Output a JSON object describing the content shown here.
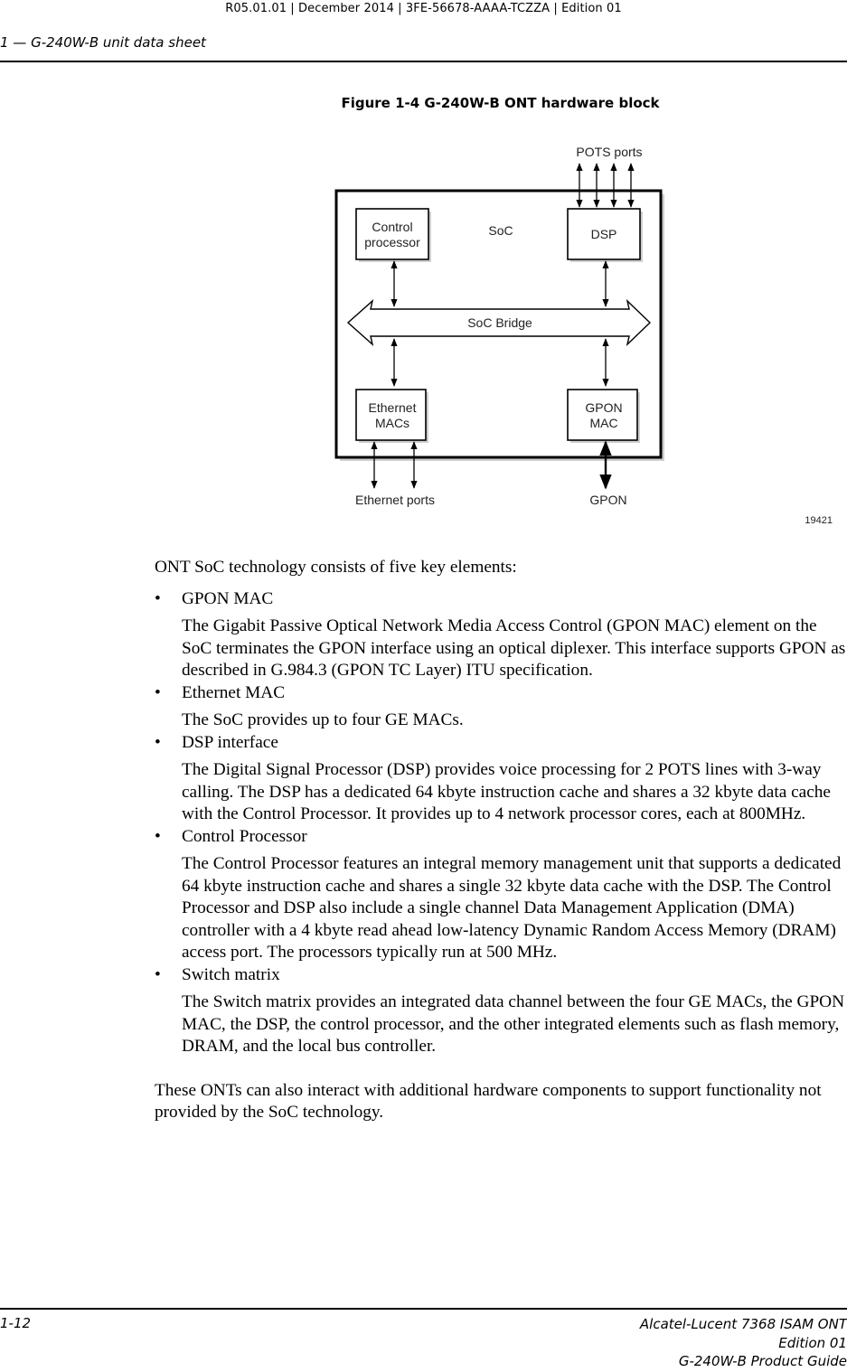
{
  "header": {
    "doc_meta": "R05.01.01 | December 2014 | 3FE-56678-AAAA-TCZZA | Edition 01",
    "chapter": "1 —  G-240W-B unit data sheet"
  },
  "figure": {
    "title": "Figure 1-4  G-240W-B ONT hardware block",
    "id": "19421",
    "labels": {
      "pots_ports": "POTS ports",
      "soc": "SoC",
      "control_processor_line1": "Control",
      "control_processor_line2": "processor",
      "dsp": "DSP",
      "soc_bridge": "SoC Bridge",
      "ethernet_macs_line1": "Ethernet",
      "ethernet_macs_line2": "MACs",
      "gpon_mac_line1": "GPON",
      "gpon_mac_line2": "MAC",
      "ethernet_ports": "Ethernet ports",
      "gpon": "GPON"
    }
  },
  "body": {
    "intro": "ONT SoC technology consists of five key elements:",
    "bullet_glyph": "•",
    "items": [
      {
        "heading": "GPON MAC",
        "text": "The Gigabit Passive Optical Network Media Access Control (GPON MAC) element on the SoC terminates the GPON interface using an optical diplexer. This interface supports GPON as described in G.984.3 (GPON TC Layer) ITU specification."
      },
      {
        "heading": "Ethernet MAC",
        "text": "The SoC provides up to four GE MACs."
      },
      {
        "heading": "DSP interface",
        "text": "The Digital Signal Processor (DSP) provides voice processing for 2 POTS lines with 3-way calling. The DSP has a dedicated 64 kbyte instruction cache and shares a 32 kbyte data cache with the Control Processor. It provides up to 4 network processor cores, each at 800MHz."
      },
      {
        "heading": "Control Processor",
        "text": "The Control Processor features an integral memory management unit that supports a dedicated 64 kbyte instruction cache and shares a single 32 kbyte data cache with the DSP. The Control Processor and DSP also include a single channel Data Management Application (DMA) controller with a 4 kbyte read ahead low-latency Dynamic Random Access Memory (DRAM) access port. The processors typically run at 500 MHz."
      },
      {
        "heading": "Switch matrix",
        "text": "The Switch matrix provides an integrated data channel between the four GE MACs, the GPON MAC, the DSP, the control processor, and the other integrated elements such as flash memory, DRAM, and the local bus controller."
      }
    ],
    "outro": "These ONTs can also interact with additional hardware components to support functionality not provided by the SoC technology."
  },
  "footer": {
    "page_number": "1-12",
    "product": "Alcatel-Lucent 7368 ISAM ONT",
    "edition": "Edition 01",
    "guide": "G-240W-B Product Guide"
  }
}
